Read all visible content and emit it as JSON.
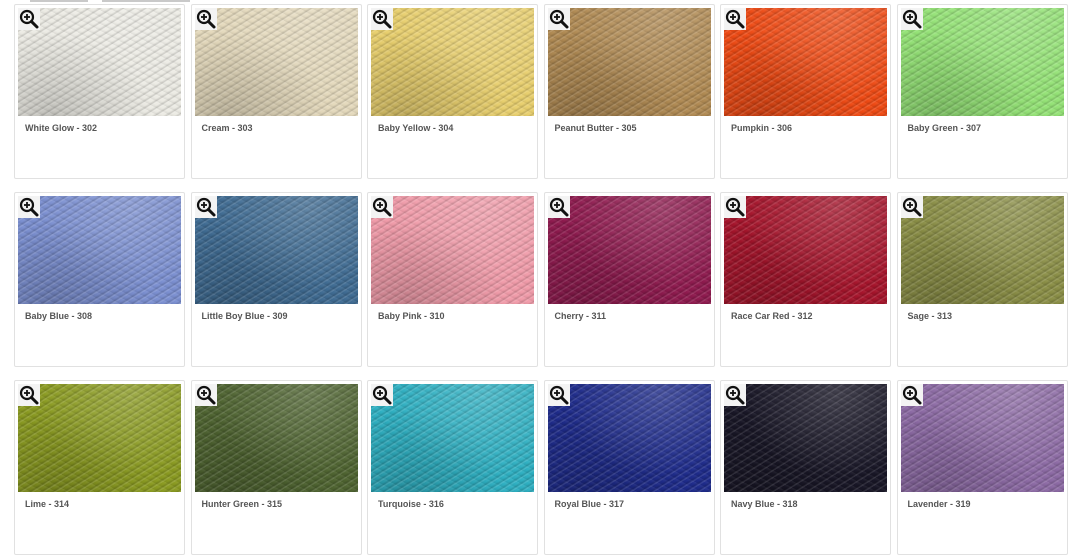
{
  "colors": {
    "card_border": "#e1e1e1",
    "label_text": "#555555",
    "zoom_icon": "#111111"
  },
  "swatches": [
    {
      "label": "White Glow - 302",
      "color": "#ecebe4"
    },
    {
      "label": "Cream - 303",
      "color": "#e4d9bc"
    },
    {
      "label": "Baby Yellow - 304",
      "color": "#e8cf6e"
    },
    {
      "label": "Peanut Butter - 305",
      "color": "#b08a53"
    },
    {
      "label": "Pumpkin - 306",
      "color": "#ee4a14"
    },
    {
      "label": "Baby Green - 307",
      "color": "#94e276"
    },
    {
      "label": "Baby Blue - 308",
      "color": "#7b8fd0"
    },
    {
      "label": "Little Boy Blue - 309",
      "color": "#3f6b92"
    },
    {
      "label": "Baby Pink - 310",
      "color": "#f09ba9"
    },
    {
      "label": "Cherry - 311",
      "color": "#8e1a4e"
    },
    {
      "label": "Race Car Red - 312",
      "color": "#a5142b"
    },
    {
      "label": "Sage - 313",
      "color": "#8a8e46"
    },
    {
      "label": "Lime - 314",
      "color": "#8a9a21"
    },
    {
      "label": "Hunter Green - 315",
      "color": "#4e6330"
    },
    {
      "label": "Turquoise - 316",
      "color": "#2eafc1"
    },
    {
      "label": "Royal Blue - 317",
      "color": "#1e2b8a"
    },
    {
      "label": "Navy Blue - 318",
      "color": "#181626"
    },
    {
      "label": "Lavender - 319",
      "color": "#8c6aa4"
    }
  ],
  "zoom_icon_name": "zoom-in-icon"
}
